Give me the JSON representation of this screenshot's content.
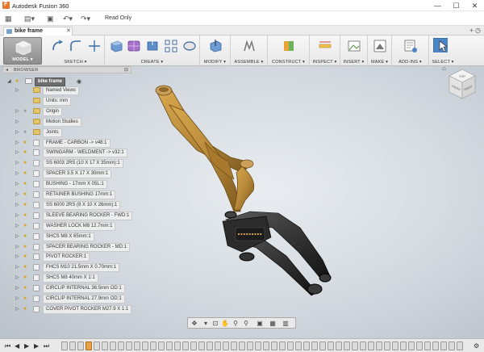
{
  "app": {
    "title": "Autodesk Fusion 360",
    "read_only": "Read Only"
  },
  "window_controls": {
    "minimize": "—",
    "maximize": "☐",
    "close": "✕"
  },
  "document_tab": {
    "label": "bike frame",
    "close": "✕",
    "extra": "+ ◷"
  },
  "ribbon": {
    "model": "MODEL ▾",
    "groups": [
      "SKETCH ▾",
      "CREATE ▾",
      "MODIFY ▾",
      "ASSEMBLE ▾",
      "CONSTRUCT ▾",
      "INSPECT ▾",
      "INSERT ▾",
      "MAKE ▾",
      "ADD-INS ▾",
      "SELECT ▾"
    ]
  },
  "browser": {
    "title": "BROWSER",
    "root": "bike frame",
    "items": [
      {
        "label": "Named Views",
        "kind": "folder"
      },
      {
        "label": "Units: mm",
        "kind": "units"
      },
      {
        "label": "Origin",
        "kind": "folder"
      },
      {
        "label": "Motion Studies",
        "kind": "folder"
      },
      {
        "label": "Joints",
        "kind": "folder"
      },
      {
        "label": "FRAME - CARBON -> v48:1",
        "kind": "component"
      },
      {
        "label": "SWINGARM - WELDMENT -> v32:1",
        "kind": "component"
      },
      {
        "label": "SS 6003 2RS (10 X 17 X 35mm):1",
        "kind": "component"
      },
      {
        "label": "SPACER 3.5 X 17 X 30mm:1",
        "kind": "component"
      },
      {
        "label": "BUSHING - 17mm X 05L:1",
        "kind": "component"
      },
      {
        "label": "RETAINER BUSHING 17mm:1",
        "kind": "component"
      },
      {
        "label": "SS 6000 2RS (8 X 10 X 26mm):1",
        "kind": "component"
      },
      {
        "label": "SLEEVE BEARING ROCKER - FWD:1",
        "kind": "component"
      },
      {
        "label": "WASHER LOCK M8 12.7mm:1",
        "kind": "component"
      },
      {
        "label": "SHCS M8 X 65mm:1",
        "kind": "component"
      },
      {
        "label": "SPACER BEARING ROCKER - MD:1",
        "kind": "component"
      },
      {
        "label": "PIVOT ROCKER:1",
        "kind": "component"
      },
      {
        "label": "FHCS M10 21.5mm X 0.70mm:1",
        "kind": "component"
      },
      {
        "label": "SHCS M8 40mm X 1:1",
        "kind": "component"
      },
      {
        "label": "CIRCLIP INTERNAL 36.5mm OD:1",
        "kind": "component"
      },
      {
        "label": "CIRCLIP INTERNAL 27.9mm OD:1",
        "kind": "component"
      },
      {
        "label": "COVER PIVOT ROCKER M27.9 X 1:1",
        "kind": "component"
      }
    ]
  },
  "viewcube": {
    "top": "TOP",
    "front": "FRONT",
    "right": "RIGHT"
  },
  "colors": {
    "frame": "#b8893a",
    "swingarm": "#2a2a2a",
    "select_blue": "#4a84c4"
  },
  "navbar": {
    "icons": [
      "orbit-icon",
      "pan-icon",
      "hand-icon",
      "zoom-icon",
      "fit-icon",
      "display-icon",
      "grid-icon",
      "viewports-icon"
    ]
  },
  "timeline": {
    "controls": [
      "⏮",
      "◀",
      "▶",
      "▶",
      "⏭"
    ],
    "feature_count": 50
  }
}
